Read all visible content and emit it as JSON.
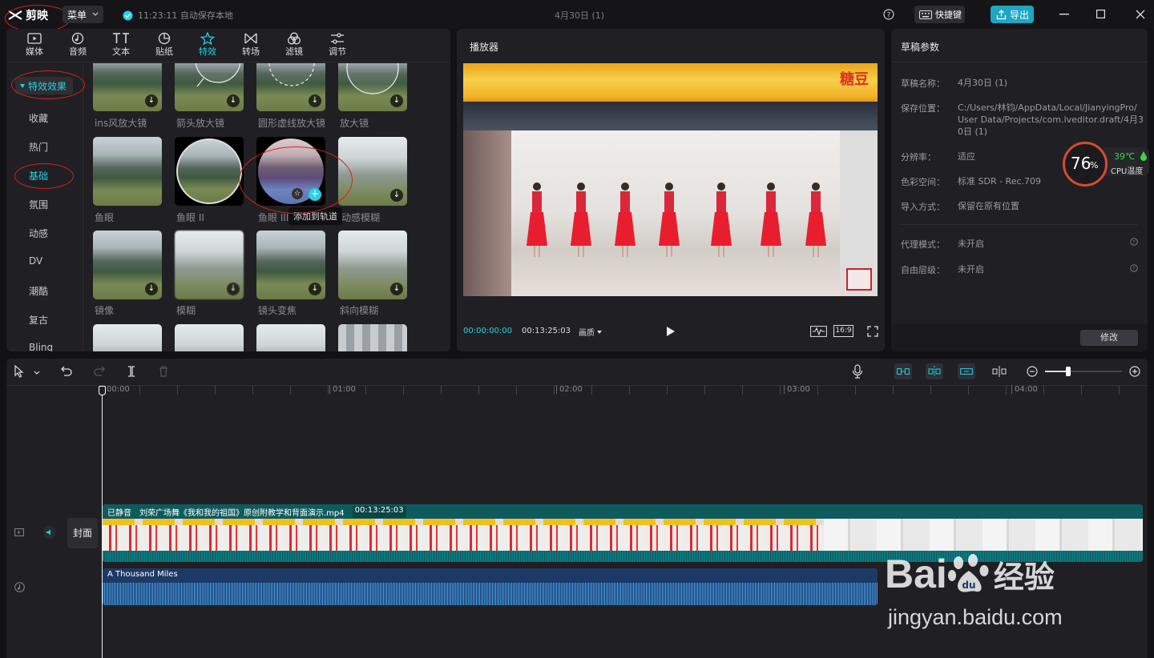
{
  "app": {
    "name": "剪映",
    "menu_label": "菜单",
    "autosave": "11:23:11 自动保存本地",
    "project_title": "4月30日 (1)",
    "shortcut_label": "快捷键",
    "export_label": "导出"
  },
  "tabs": [
    {
      "label": "媒体",
      "icon": "media-icon"
    },
    {
      "label": "音频",
      "icon": "audio-icon"
    },
    {
      "label": "文本",
      "icon": "text-icon"
    },
    {
      "label": "贴纸",
      "icon": "sticker-icon"
    },
    {
      "label": "特效",
      "icon": "effects-icon",
      "active": true
    },
    {
      "label": "转场",
      "icon": "transition-icon"
    },
    {
      "label": "滤镜",
      "icon": "filter-icon"
    },
    {
      "label": "调节",
      "icon": "adjust-icon"
    }
  ],
  "categories": {
    "header": "特效效果",
    "items": [
      "收藏",
      "热门",
      "基础",
      "氛围",
      "动感",
      "DV",
      "潮酷",
      "复古",
      "Bling"
    ],
    "selected": "基础"
  },
  "effects": {
    "row0": [
      "ins风放大镜",
      "箭头放大镜",
      "圆形虚线放大镜",
      "放大镜"
    ],
    "row1": [
      "鱼眼",
      "鱼眼 II",
      "鱼眼 III",
      "动感模糊"
    ],
    "row2": [
      "镜像",
      "模糊",
      "镜头变焦",
      "斜向模糊"
    ],
    "tooltip": "添加到轨道"
  },
  "player": {
    "title": "播放器",
    "current_time": "00:00:00:00",
    "total_time": "00:13:25:03",
    "quality": "画质",
    "ratio": "16:9",
    "watermark": "糖豆"
  },
  "draft": {
    "title": "草稿参数",
    "fields": [
      {
        "label": "草稿名称：",
        "value": "4月30日 (1)"
      },
      {
        "label": "保存位置：",
        "value_lines": [
          "C:/Users/林钧/AppData/Local/JianyingPro/",
          "User Data/Projects/com.lveditor.draft/4月3",
          "0日 (1)"
        ]
      },
      {
        "label": "分辨率：",
        "value": "适应"
      },
      {
        "label": "色彩空间：",
        "value": "标准 SDR - Rec.709"
      },
      {
        "label": "导入方式：",
        "value": "保留在原有位置"
      },
      {
        "label": "代理模式：",
        "value": "未开启"
      },
      {
        "label": "自由层级：",
        "value": "未开启"
      }
    ],
    "modify_label": "修改"
  },
  "cpu": {
    "percent": "76",
    "percent_sign": "%",
    "temp": "39℃",
    "label": "CPU温度",
    "level": 0.76
  },
  "timeline": {
    "ruler": [
      "00:00",
      "01:00",
      "02:00",
      "03:00",
      "04:00"
    ],
    "cover_label": "封面",
    "video_clip": {
      "muted": "已静音",
      "name": "刘荣广场舞《我和我的祖国》原创附教学和背面演示.mp4",
      "duration": "00:13:25:03"
    },
    "audio_clip": {
      "name": "A Thousand Miles"
    }
  },
  "watermark": {
    "brand": "Bai",
    "brand2": "经验",
    "url": "jingyan.baidu.com"
  },
  "colors": {
    "accent": "#22d3e6",
    "export": "#1ea5c3",
    "video_track": "#0e5b5f",
    "audio_track": "#1d3a66",
    "annotation": "#d42020"
  }
}
